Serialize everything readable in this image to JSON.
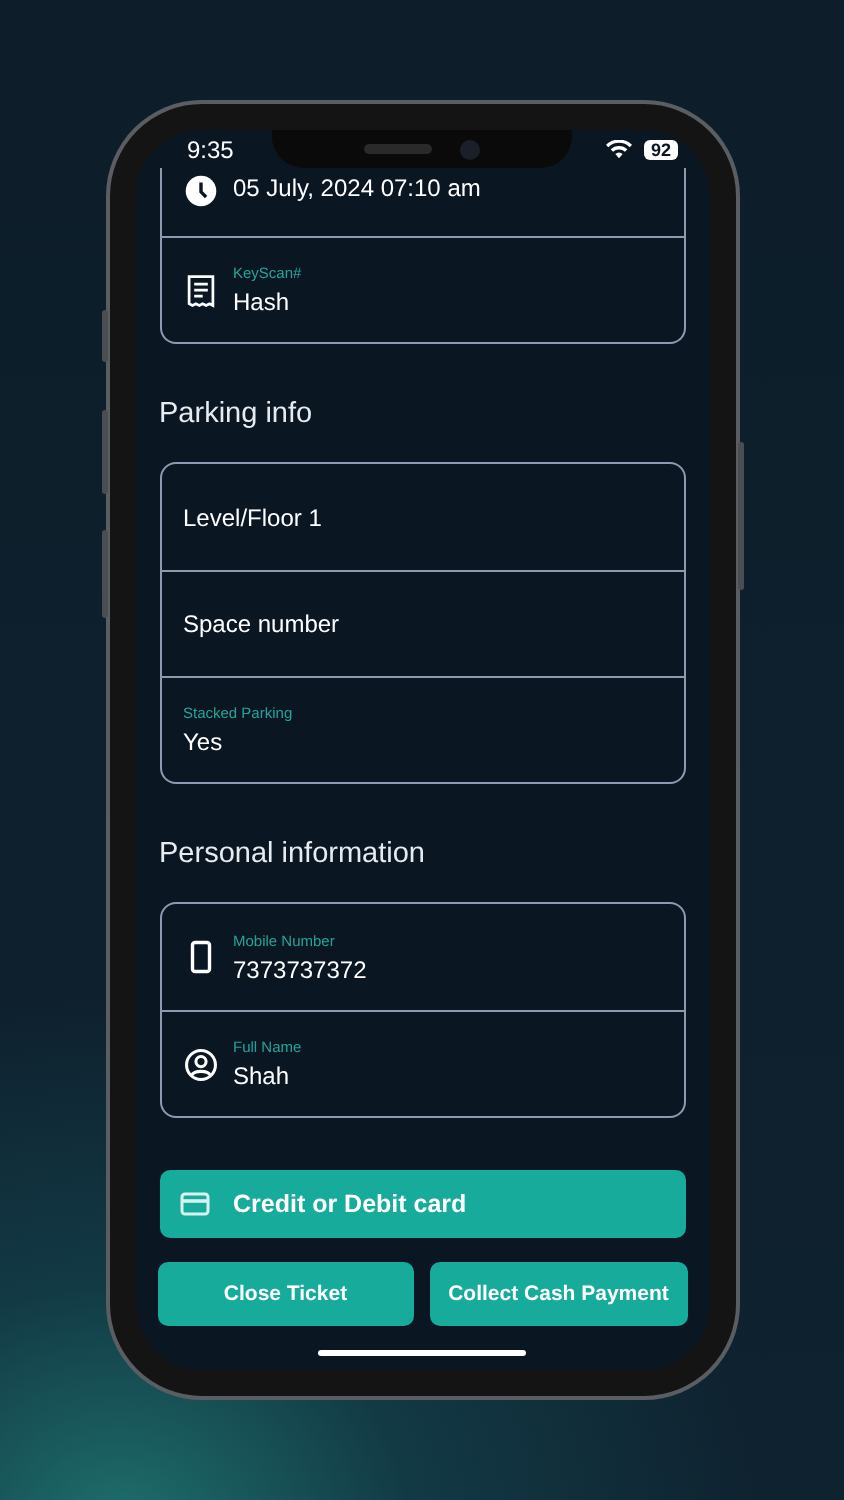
{
  "status_bar": {
    "time": "9:35",
    "battery": "92"
  },
  "ticket_card": {
    "fields": [
      {
        "kind": "clock",
        "value": "05 July, 2024 07:10 am"
      },
      {
        "kind": "receipt",
        "label": "KeyScan#",
        "value": "Hash"
      }
    ]
  },
  "sections": [
    {
      "title": "Parking info",
      "fields": [
        {
          "kind": "plain",
          "value": "Level/Floor 1"
        },
        {
          "kind": "plain",
          "value": "Space number"
        },
        {
          "kind": "plain",
          "label": "Stacked Parking",
          "value": "Yes"
        }
      ]
    },
    {
      "title": "Personal information",
      "fields": [
        {
          "kind": "phone",
          "label": "Mobile Number",
          "value": "7373737372"
        },
        {
          "kind": "person",
          "label": "Full Name",
          "value": "Shah"
        }
      ]
    }
  ],
  "card_button": {
    "label": "Credit or Debit card"
  },
  "buttons": [
    {
      "label": "Close Ticket"
    },
    {
      "label": "Collect Cash Payment"
    }
  ]
}
